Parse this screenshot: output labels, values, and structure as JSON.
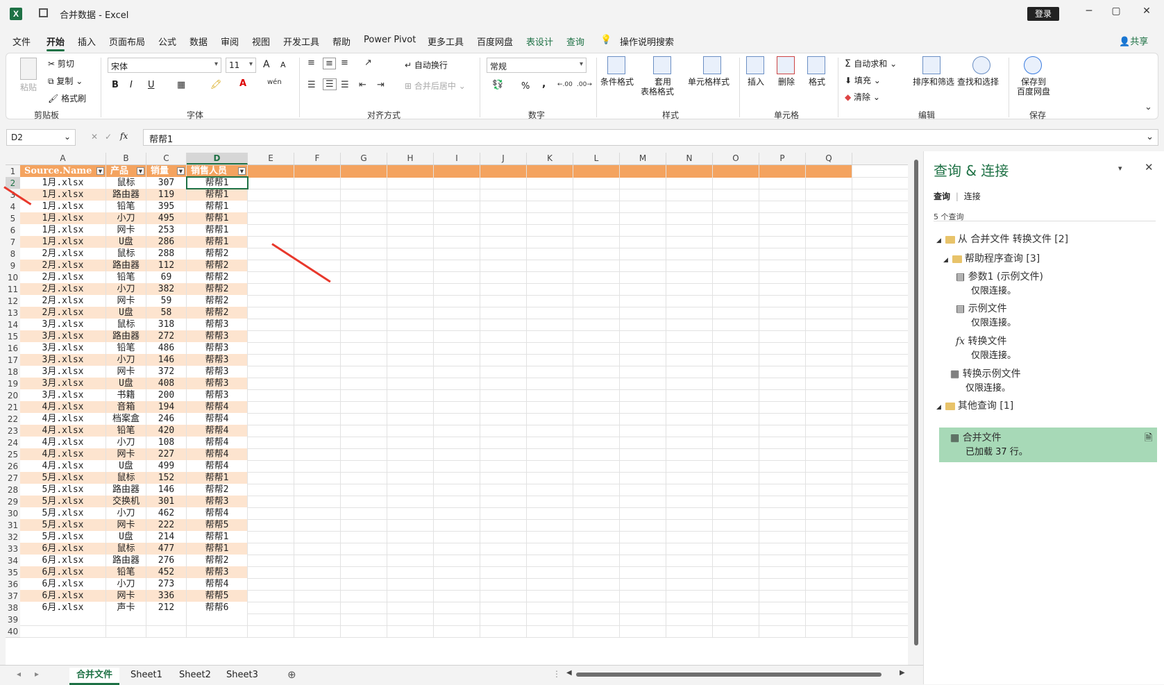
{
  "titlebar": {
    "app_icon": "X",
    "title": "合并数据  -  Excel",
    "login": "登录",
    "min": "─",
    "max": "▢",
    "close": "✕"
  },
  "menu": [
    "文件",
    "开始",
    "插入",
    "页面布局",
    "公式",
    "数据",
    "审阅",
    "视图",
    "开发工具",
    "帮助",
    "Power Pivot",
    "更多工具",
    "百度网盘",
    "表设计",
    "查询",
    "操作说明搜索"
  ],
  "share": "共享",
  "ribbon": {
    "clipboard": {
      "paste": "粘贴",
      "cut": "剪切",
      "copy": "复制",
      "painter": "格式刷",
      "label": "剪贴板"
    },
    "font": {
      "name": "宋体",
      "size": "11",
      "bold": "B",
      "italic": "I",
      "underline": "U",
      "grow": "A",
      "shrink": "A",
      "label": "字体"
    },
    "align": {
      "wrap": "自动换行",
      "merge": "合并后居中",
      "label": "对齐方式"
    },
    "number": {
      "format": "常规",
      "percent": "%",
      "comma": ",",
      "label": "数字"
    },
    "styles": {
      "cond": "条件格式",
      "table1": "套用",
      "table2": "表格格式",
      "cell": "单元格样式",
      "label": "样式"
    },
    "cells": {
      "insert": "插入",
      "delete": "删除",
      "format": "格式",
      "label": "单元格"
    },
    "edit": {
      "autosum": "自动求和",
      "fill": "填充",
      "clear": "清除",
      "sort": "排序和筛选",
      "find": "查找和选择",
      "label": "编辑"
    },
    "save": {
      "btn1": "保存到",
      "btn2": "百度网盘",
      "label": "保存"
    }
  },
  "formula": {
    "namebox": "D2",
    "value": "帮帮1",
    "fx": "fx"
  },
  "columns": [
    "A",
    "B",
    "C",
    "D",
    "E",
    "F",
    "G",
    "H",
    "I",
    "J",
    "K",
    "L",
    "M",
    "N",
    "O",
    "P",
    "Q"
  ],
  "headers": [
    "Source.Name",
    "产品",
    "销量",
    "销售人员"
  ],
  "rows": [
    [
      "1月.xlsx",
      "鼠标",
      "307",
      "帮帮1"
    ],
    [
      "1月.xlsx",
      "路由器",
      "119",
      "帮帮1"
    ],
    [
      "1月.xlsx",
      "铅笔",
      "395",
      "帮帮1"
    ],
    [
      "1月.xlsx",
      "小刀",
      "495",
      "帮帮1"
    ],
    [
      "1月.xlsx",
      "网卡",
      "253",
      "帮帮1"
    ],
    [
      "1月.xlsx",
      "U盘",
      "286",
      "帮帮1"
    ],
    [
      "2月.xlsx",
      "鼠标",
      "288",
      "帮帮2"
    ],
    [
      "2月.xlsx",
      "路由器",
      "112",
      "帮帮2"
    ],
    [
      "2月.xlsx",
      "铅笔",
      "69",
      "帮帮2"
    ],
    [
      "2月.xlsx",
      "小刀",
      "382",
      "帮帮2"
    ],
    [
      "2月.xlsx",
      "网卡",
      "59",
      "帮帮2"
    ],
    [
      "2月.xlsx",
      "U盘",
      "58",
      "帮帮2"
    ],
    [
      "3月.xlsx",
      "鼠标",
      "318",
      "帮帮3"
    ],
    [
      "3月.xlsx",
      "路由器",
      "272",
      "帮帮3"
    ],
    [
      "3月.xlsx",
      "铅笔",
      "486",
      "帮帮3"
    ],
    [
      "3月.xlsx",
      "小刀",
      "146",
      "帮帮3"
    ],
    [
      "3月.xlsx",
      "网卡",
      "372",
      "帮帮3"
    ],
    [
      "3月.xlsx",
      "U盘",
      "408",
      "帮帮3"
    ],
    [
      "3月.xlsx",
      "书籍",
      "200",
      "帮帮3"
    ],
    [
      "4月.xlsx",
      "音箱",
      "194",
      "帮帮4"
    ],
    [
      "4月.xlsx",
      "档案盒",
      "246",
      "帮帮4"
    ],
    [
      "4月.xlsx",
      "铅笔",
      "420",
      "帮帮4"
    ],
    [
      "4月.xlsx",
      "小刀",
      "108",
      "帮帮4"
    ],
    [
      "4月.xlsx",
      "网卡",
      "227",
      "帮帮4"
    ],
    [
      "4月.xlsx",
      "U盘",
      "499",
      "帮帮4"
    ],
    [
      "5月.xlsx",
      "鼠标",
      "152",
      "帮帮1"
    ],
    [
      "5月.xlsx",
      "路由器",
      "146",
      "帮帮2"
    ],
    [
      "5月.xlsx",
      "交换机",
      "301",
      "帮帮3"
    ],
    [
      "5月.xlsx",
      "小刀",
      "462",
      "帮帮4"
    ],
    [
      "5月.xlsx",
      "网卡",
      "222",
      "帮帮5"
    ],
    [
      "5月.xlsx",
      "U盘",
      "214",
      "帮帮1"
    ],
    [
      "6月.xlsx",
      "鼠标",
      "477",
      "帮帮1"
    ],
    [
      "6月.xlsx",
      "路由器",
      "276",
      "帮帮2"
    ],
    [
      "6月.xlsx",
      "铅笔",
      "452",
      "帮帮3"
    ],
    [
      "6月.xlsx",
      "小刀",
      "273",
      "帮帮4"
    ],
    [
      "6月.xlsx",
      "网卡",
      "336",
      "帮帮5"
    ],
    [
      "6月.xlsx",
      "声卡",
      "212",
      "帮帮6"
    ]
  ],
  "row_numbers": [
    "1",
    "2",
    "3",
    "4",
    "5",
    "6",
    "7",
    "8",
    "9",
    "10",
    "11",
    "12",
    "13",
    "14",
    "15",
    "16",
    "17",
    "18",
    "19",
    "20",
    "21",
    "22",
    "23",
    "24",
    "25",
    "26",
    "27",
    "28",
    "29",
    "30",
    "31",
    "32",
    "33",
    "34",
    "35",
    "36",
    "37",
    "38",
    "39",
    "40"
  ],
  "sheets": [
    "合并文件",
    "Sheet1",
    "Sheet2",
    "Sheet3"
  ],
  "query_pane": {
    "title": "查询 & 连接",
    "tab_query": "查询",
    "tab_conn": "连接",
    "count": "5 个查询",
    "group1": "从 合并文件 转换文件 [2]",
    "group2": "帮助程序查询 [3]",
    "items": [
      {
        "name": "参数1 (示例文件)",
        "status": "仅限连接。"
      },
      {
        "name": "示例文件",
        "status": "仅限连接。"
      },
      {
        "name": "转换文件",
        "status": "仅限连接。"
      },
      {
        "name": "转换示例文件",
        "status": "仅限连接。"
      }
    ],
    "group3": "其他查询 [1]",
    "selected": {
      "name": "合并文件",
      "status": "已加载 37 行。"
    }
  },
  "colors": {
    "accent": "#1e7145",
    "table_header": "#f4a35f",
    "band": "#fde4cf",
    "arrow": "#e8382c",
    "query_selected": "#a7d9b7"
  }
}
